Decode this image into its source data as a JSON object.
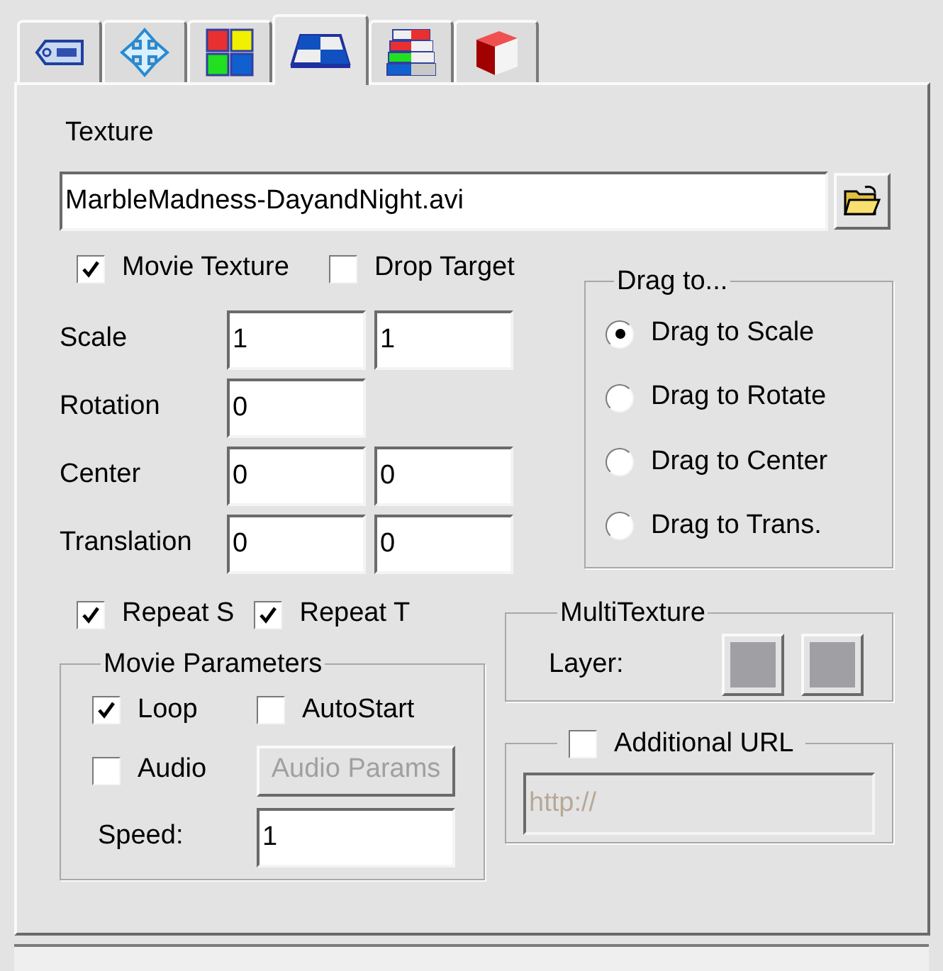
{
  "tabs": [
    {
      "kind": "tag",
      "selected": false
    },
    {
      "kind": "move",
      "selected": false
    },
    {
      "kind": "colors",
      "selected": false
    },
    {
      "kind": "texture",
      "selected": true
    },
    {
      "kind": "layers",
      "selected": false
    },
    {
      "kind": "cube",
      "selected": false
    }
  ],
  "texture": {
    "label": "Texture",
    "value": "MarbleMadness-DayandNight.avi"
  },
  "options": [
    {
      "label": "Movie Texture",
      "checked": true
    },
    {
      "label": "Drop Target",
      "checked": false
    }
  ],
  "fields": [
    {
      "label": "Scale",
      "values": [
        "1",
        "1"
      ]
    },
    {
      "label": "Rotation",
      "values": [
        "0"
      ]
    },
    {
      "label": "Center",
      "values": [
        "0",
        "0"
      ]
    },
    {
      "label": "Translation",
      "values": [
        "0",
        "0"
      ]
    }
  ],
  "drag_to": {
    "title": "Drag to...",
    "options": [
      {
        "label": "Drag to Scale",
        "selected": true
      },
      {
        "label": "Drag to Rotate",
        "selected": false
      },
      {
        "label": "Drag to Center",
        "selected": false
      },
      {
        "label": "Drag to Trans.",
        "selected": false
      }
    ]
  },
  "repeat": [
    {
      "label": "Repeat S",
      "checked": true
    },
    {
      "label": "Repeat T",
      "checked": true
    }
  ],
  "movie_parameters": {
    "title": "Movie Parameters",
    "checkboxes": [
      {
        "label": "Loop",
        "checked": true
      },
      {
        "label": "AutoStart",
        "checked": false
      },
      {
        "label": "Audio",
        "checked": false
      }
    ],
    "audio_params_button": {
      "label": "Audio Params",
      "disabled": true
    },
    "speed": {
      "label": "Speed:",
      "value": "1"
    }
  },
  "multitexture": {
    "title": "MultiTexture",
    "label": "Layer:",
    "layers": [
      {
        "kind": "swatch"
      },
      {
        "kind": "swatch"
      }
    ]
  },
  "additional_url": {
    "label": "Additional URL",
    "checked": false,
    "placeholder": "http://",
    "disabled": true
  }
}
